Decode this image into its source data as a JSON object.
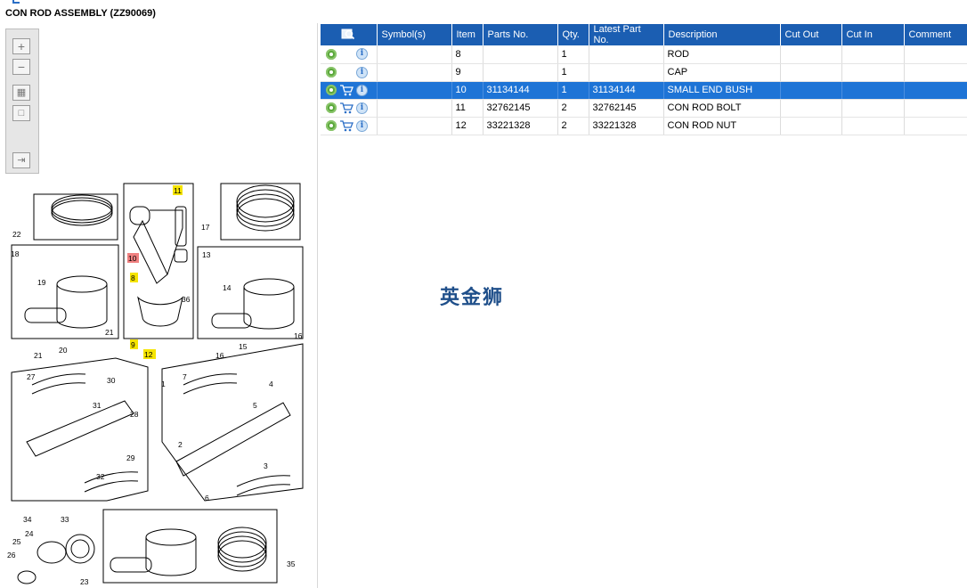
{
  "header": {
    "title": "CON ROD ASSEMBLY (ZZ90069)"
  },
  "toolbox": {
    "icons": [
      "zoom-in-icon",
      "zoom-out-icon",
      "fit-all-icon",
      "actual-size-icon",
      "export-icon"
    ]
  },
  "diagram": {
    "callouts": [
      "22",
      "18",
      "19",
      "21",
      "20",
      "21",
      "11",
      "10",
      "8",
      "36",
      "9",
      "12",
      "7",
      "17",
      "13",
      "14",
      "16",
      "15",
      "16",
      "27",
      "30",
      "31",
      "28",
      "29",
      "32",
      "34",
      "33",
      "24",
      "25",
      "26",
      "23",
      "1",
      "4",
      "5",
      "2",
      "3",
      "6",
      "35"
    ]
  },
  "table": {
    "columns": [
      "",
      "Symbol(s)",
      "Item",
      "Parts No.",
      "Qty.",
      "Latest Part No.",
      "Description",
      "Cut Out",
      "Cut In",
      "Comment"
    ],
    "rows": [
      {
        "item": "8",
        "parts_no": "",
        "qty": "1",
        "latest": "",
        "desc": "ROD",
        "cart": false,
        "selected": false
      },
      {
        "item": "9",
        "parts_no": "",
        "qty": "1",
        "latest": "",
        "desc": "CAP",
        "cart": false,
        "selected": false
      },
      {
        "item": "10",
        "parts_no": "31134144",
        "qty": "1",
        "latest": "31134144",
        "desc": "SMALL END BUSH",
        "cart": true,
        "selected": true
      },
      {
        "item": "11",
        "parts_no": "32762145",
        "qty": "2",
        "latest": "32762145",
        "desc": "CON ROD BOLT",
        "cart": true,
        "selected": false
      },
      {
        "item": "12",
        "parts_no": "33221328",
        "qty": "2",
        "latest": "33221328",
        "desc": "CON ROD NUT",
        "cart": true,
        "selected": false
      }
    ]
  },
  "watermark": "英金狮",
  "colors": {
    "header_bg": "#1b5eb2",
    "selection": "#1e74d6",
    "highlight_yellow": "#f5e400",
    "highlight_red": "#f08080"
  }
}
